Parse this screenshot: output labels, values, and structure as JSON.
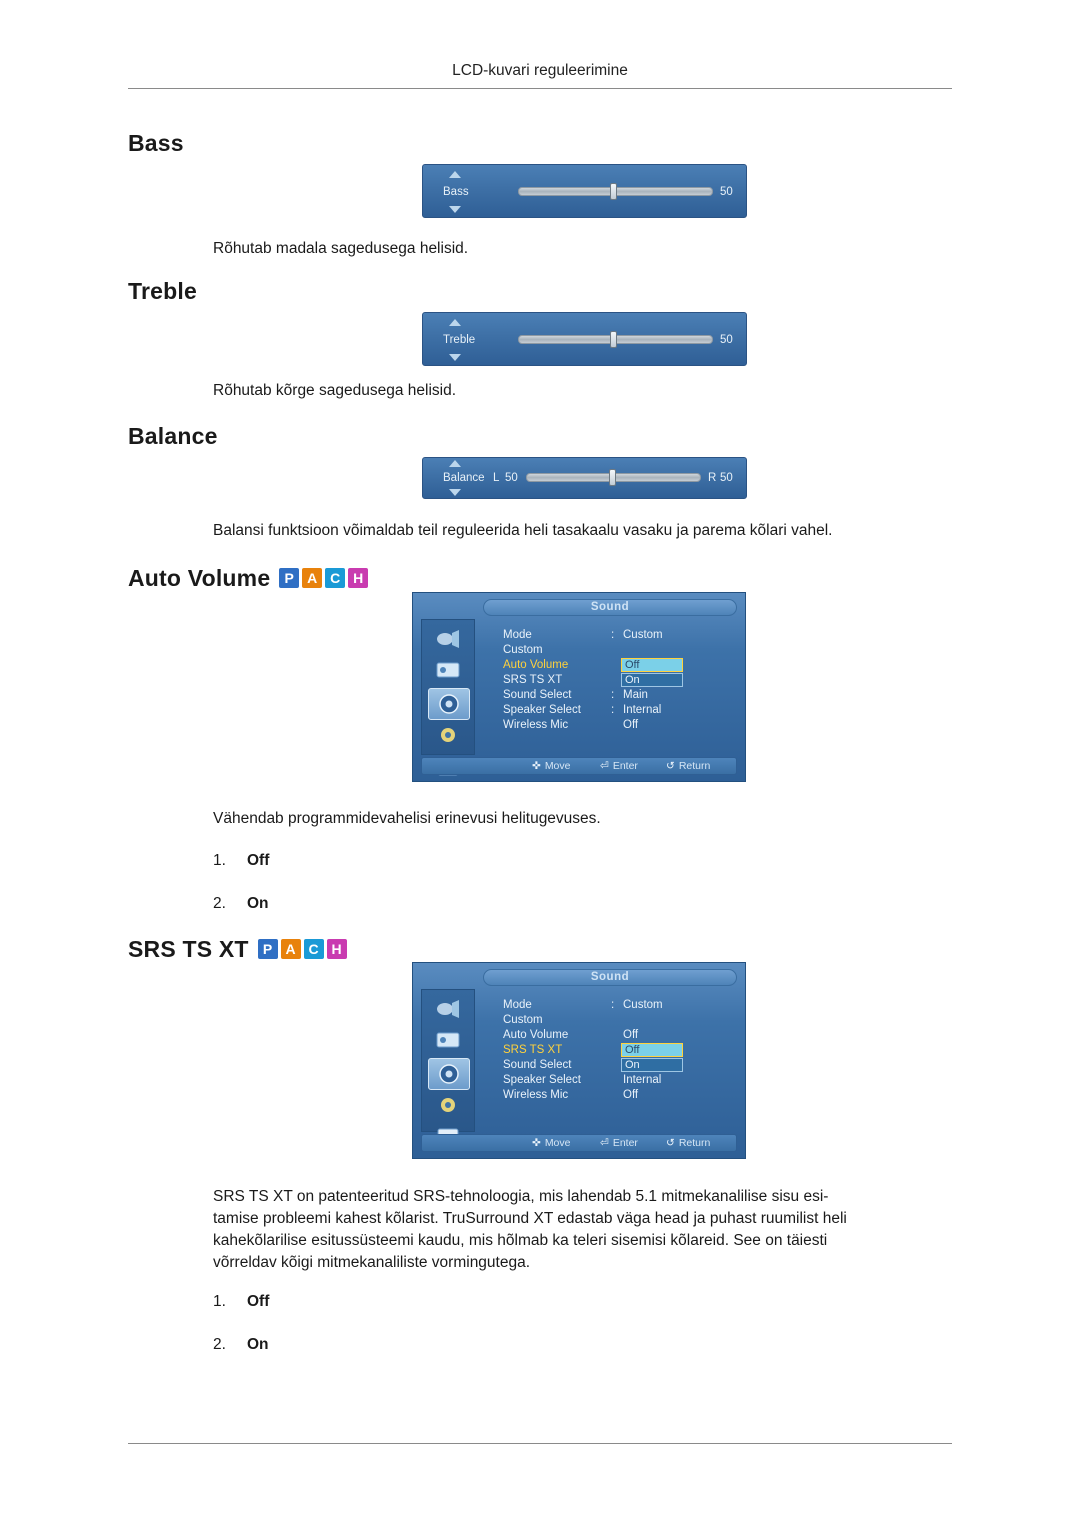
{
  "header": {
    "title": "LCD-kuvari reguleerimine"
  },
  "badges": [
    {
      "letter": "P",
      "color": "#2f6fc4"
    },
    {
      "letter": "A",
      "color": "#e8820c"
    },
    {
      "letter": "C",
      "color": "#1a9ad6"
    },
    {
      "letter": "H",
      "color": "#c93bb0"
    }
  ],
  "sections": {
    "bass": {
      "title": "Bass",
      "osd": {
        "label": "Bass",
        "value": "50"
      },
      "description": "Rõhutab madala sagedusega helisid."
    },
    "treble": {
      "title": "Treble",
      "osd": {
        "label": "Treble",
        "value": "50"
      },
      "description": "Rõhutab kõrge sagedusega helisid."
    },
    "balance": {
      "title": "Balance",
      "osd": {
        "label": "Balance",
        "left_label": "L",
        "left_value": "50",
        "right_label": "R",
        "right_value": "50"
      },
      "description": "Balansi funktsioon võimaldab teil reguleerida heli tasakaalu vasaku ja parema kõlari vahel."
    },
    "auto_volume": {
      "title": "Auto Volume",
      "description": "Vähendab programmidevahelisi erinevusi helitugevuses.",
      "options": [
        {
          "num": "1.",
          "label": "Off"
        },
        {
          "num": "2.",
          "label": "On"
        }
      ]
    },
    "srs_ts_xt": {
      "title": "SRS TS XT",
      "description": "SRS TS XT on patenteeritud SRS-tehnoloogia, mis lahendab 5.1 mitmekanalilise sisu esi-tamise probleemi kahest kõlarist. TruSurround XT edastab väga head ja puhast ruumilist heli kahekõlarilise esitussüsteemi kaudu, mis hõlmab ka teleri sisemisi kõlareid. See on täiesti võrreldav kõigi mitmekanaliliste vormingutega.",
      "description_lines": [
        "SRS TS XT on patenteeritud SRS-tehnoloogia, mis lahendab 5.1 mitmekanalilise sisu esi-",
        "tamise probleemi kahest kõlarist. TruSurround XT edastab väga head ja puhast ruumilist heli",
        "kahekõlarilise esitussüsteemi kaudu, mis hõlmab ka teleri sisemisi kõlareid. See on täiesti",
        "võrreldav kõigi mitmekanaliliste vormingutega."
      ],
      "options": [
        {
          "num": "1.",
          "label": "Off"
        },
        {
          "num": "2.",
          "label": "On"
        }
      ]
    }
  },
  "sound_menu_auto_volume": {
    "title": "Sound",
    "rows": [
      {
        "label": "Mode",
        "value": "Custom",
        "dot": ":"
      },
      {
        "label": "Custom",
        "value": "",
        "dot": ""
      },
      {
        "label": "Auto Volume",
        "value": "",
        "dot": ""
      },
      {
        "label": "SRS TS XT",
        "value": "",
        "dot": ""
      },
      {
        "label": "Sound Select",
        "value": "Main",
        "dot": ":"
      },
      {
        "label": "Speaker Select",
        "value": "Internal",
        "dot": ":"
      },
      {
        "label": "Wireless Mic",
        "value": "Off",
        "dot": ""
      }
    ],
    "highlighted_row": "Auto Volume",
    "dropdown": {
      "off": "Off",
      "on": "On"
    },
    "footer": [
      {
        "glyph": "✜",
        "label": "Move"
      },
      {
        "glyph": "⏎",
        "label": "Enter"
      },
      {
        "glyph": "↺",
        "label": "Return"
      }
    ]
  },
  "sound_menu_srs": {
    "title": "Sound",
    "rows": [
      {
        "label": "Mode",
        "value": "Custom",
        "dot": ":"
      },
      {
        "label": "Custom",
        "value": "",
        "dot": ""
      },
      {
        "label": "Auto Volume",
        "value": "Off",
        "dot": ""
      },
      {
        "label": "SRS TS XT",
        "value": "",
        "dot": ""
      },
      {
        "label": "Sound Select",
        "value": "",
        "dot": ""
      },
      {
        "label": "Speaker Select",
        "value": "Internal",
        "dot": ""
      },
      {
        "label": "Wireless Mic",
        "value": "Off",
        "dot": ""
      }
    ],
    "highlighted_row": "SRS TS XT",
    "dropdown": {
      "off": "Off",
      "on": "On"
    },
    "footer": [
      {
        "glyph": "✜",
        "label": "Move"
      },
      {
        "glyph": "⏎",
        "label": "Enter"
      },
      {
        "glyph": "↺",
        "label": "Return"
      }
    ]
  }
}
